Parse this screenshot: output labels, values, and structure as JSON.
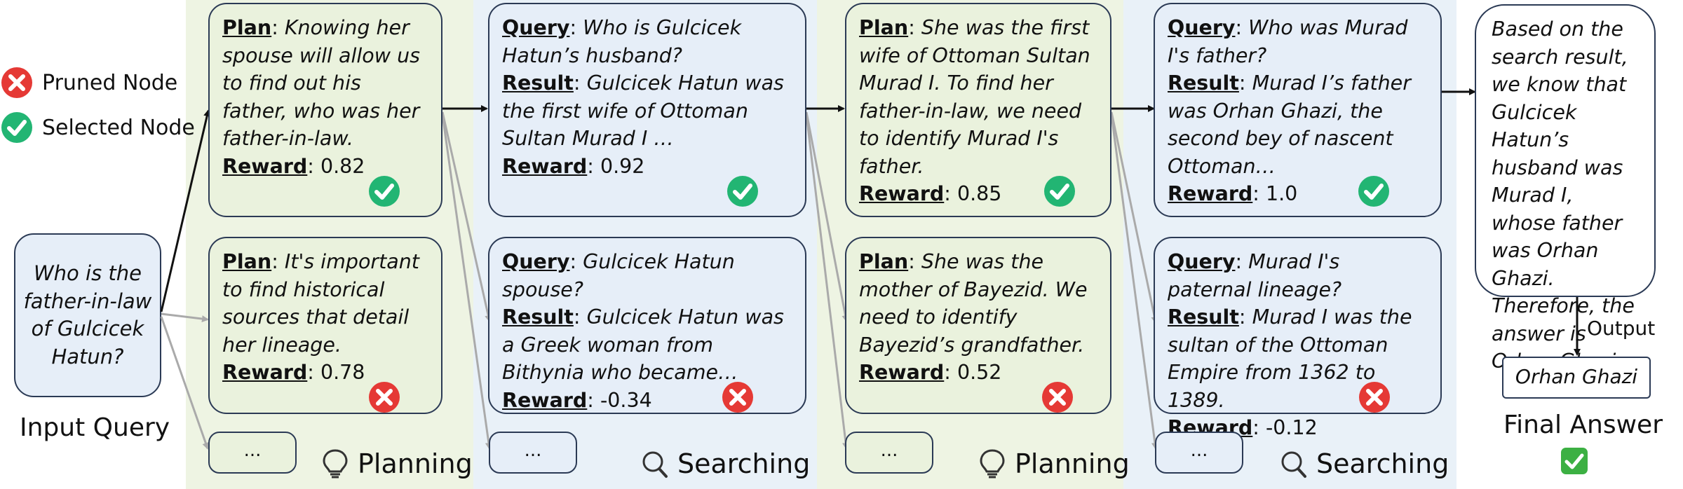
{
  "legend": {
    "pruned": "Pruned Node",
    "selected": "Selected Node"
  },
  "input": {
    "query": "Who is the father-in-law of Gulcicek Hatun?",
    "label": "Input Query"
  },
  "stages": [
    {
      "name": "Planning",
      "icon": "lightbulb-icon"
    },
    {
      "name": "Searching",
      "icon": "magnifier-icon"
    },
    {
      "name": "Planning",
      "icon": "lightbulb-icon"
    },
    {
      "name": "Searching",
      "icon": "magnifier-icon"
    }
  ],
  "nodes": {
    "p1a": {
      "label": "Plan",
      "text": "Knowing her spouse will allow us to find out his father, who was her father-in-law.",
      "reward_label": "Reward",
      "reward": "0.82",
      "status": "selected"
    },
    "p1b": {
      "label": "Plan",
      "text": "It's important to find historical sources that detail her lineage.",
      "reward_label": "Reward",
      "reward": "0.78",
      "status": "pruned"
    },
    "s1a": {
      "query_label": "Query",
      "query": "Who is Gulcicek Hatun’s husband?",
      "result_label": "Result",
      "result": "Gulcicek Hatun was the first wife of Ottoman Sultan Murad I …",
      "reward_label": "Reward",
      "reward": "0.92",
      "status": "selected"
    },
    "s1b": {
      "query_label": "Query",
      "query": "Gulcicek Hatun spouse?",
      "result_label": "Result",
      "result": "Gulcicek Hatun was a Greek woman from Bithynia who became…",
      "reward_label": "Reward",
      "reward": "-0.34",
      "status": "pruned"
    },
    "p2a": {
      "label": "Plan",
      "text": "She was the first wife of Ottoman Sultan Murad I. To find her father-in-law, we need to identify Murad I's father.",
      "reward_label": "Reward",
      "reward": "0.85",
      "status": "selected"
    },
    "p2b": {
      "label": "Plan",
      "text": "She was the mother of Bayezid. We need to identify Bayezid’s grandfather.",
      "reward_label": "Reward",
      "reward": "0.52",
      "status": "pruned"
    },
    "s2a": {
      "query_label": "Query",
      "query": "Who was Murad I's father?",
      "result_label": "Result",
      "result": "Murad I’s father was Orhan Ghazi, the second bey of nascent Ottoman…",
      "reward_label": "Reward",
      "reward": "1.0",
      "status": "selected"
    },
    "s2b": {
      "query_label": "Query",
      "query": "Murad I's paternal lineage?",
      "result_label": "Result",
      "result": "Murad I was the sultan of the Ottoman Empire from 1362 to 1389.",
      "reward_label": "Reward",
      "reward": "-0.12",
      "status": "pruned"
    }
  },
  "ellipsis": "...",
  "final": {
    "reasoning": "Based on the search result, we know that Gulcicek Hatun’s husband was Murad I, whose father was Orhan Ghazi. Therefore, the answer is Orhan Ghazi.",
    "output_label": "Output",
    "answer": "Orhan Ghazi",
    "answer_label": "Final Answer"
  },
  "colors": {
    "planning_band": "#eef4e3",
    "searching_band": "#e9f1f8",
    "selected": "#22b573",
    "pruned": "#e53935",
    "border": "#2b3a55"
  }
}
